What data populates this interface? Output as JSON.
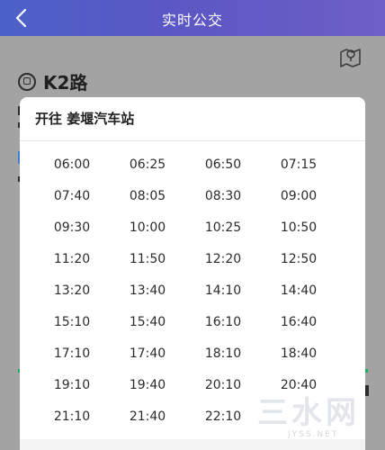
{
  "header": {
    "title": "实时公交"
  },
  "route": {
    "name": "K2路"
  },
  "modal": {
    "heading": "开往 姜堰汽车站",
    "times": [
      "06:00",
      "06:25",
      "06:50",
      "07:15",
      "07:40",
      "08:05",
      "08:30",
      "09:00",
      "09:30",
      "10:00",
      "10:25",
      "10:50",
      "11:20",
      "11:50",
      "12:20",
      "12:50",
      "13:20",
      "13:40",
      "14:10",
      "14:40",
      "15:10",
      "15:40",
      "16:10",
      "16:40",
      "17:10",
      "17:40",
      "18:10",
      "18:40",
      "19:10",
      "19:40",
      "20:10",
      "20:40",
      "21:10",
      "21:40",
      "22:10"
    ]
  },
  "watermark": {
    "text": "三水网",
    "domain": "JYSS.NET"
  },
  "colors": {
    "header_start": "#4b61c8",
    "header_end": "#6e5fc6",
    "accent": "#20a862"
  }
}
